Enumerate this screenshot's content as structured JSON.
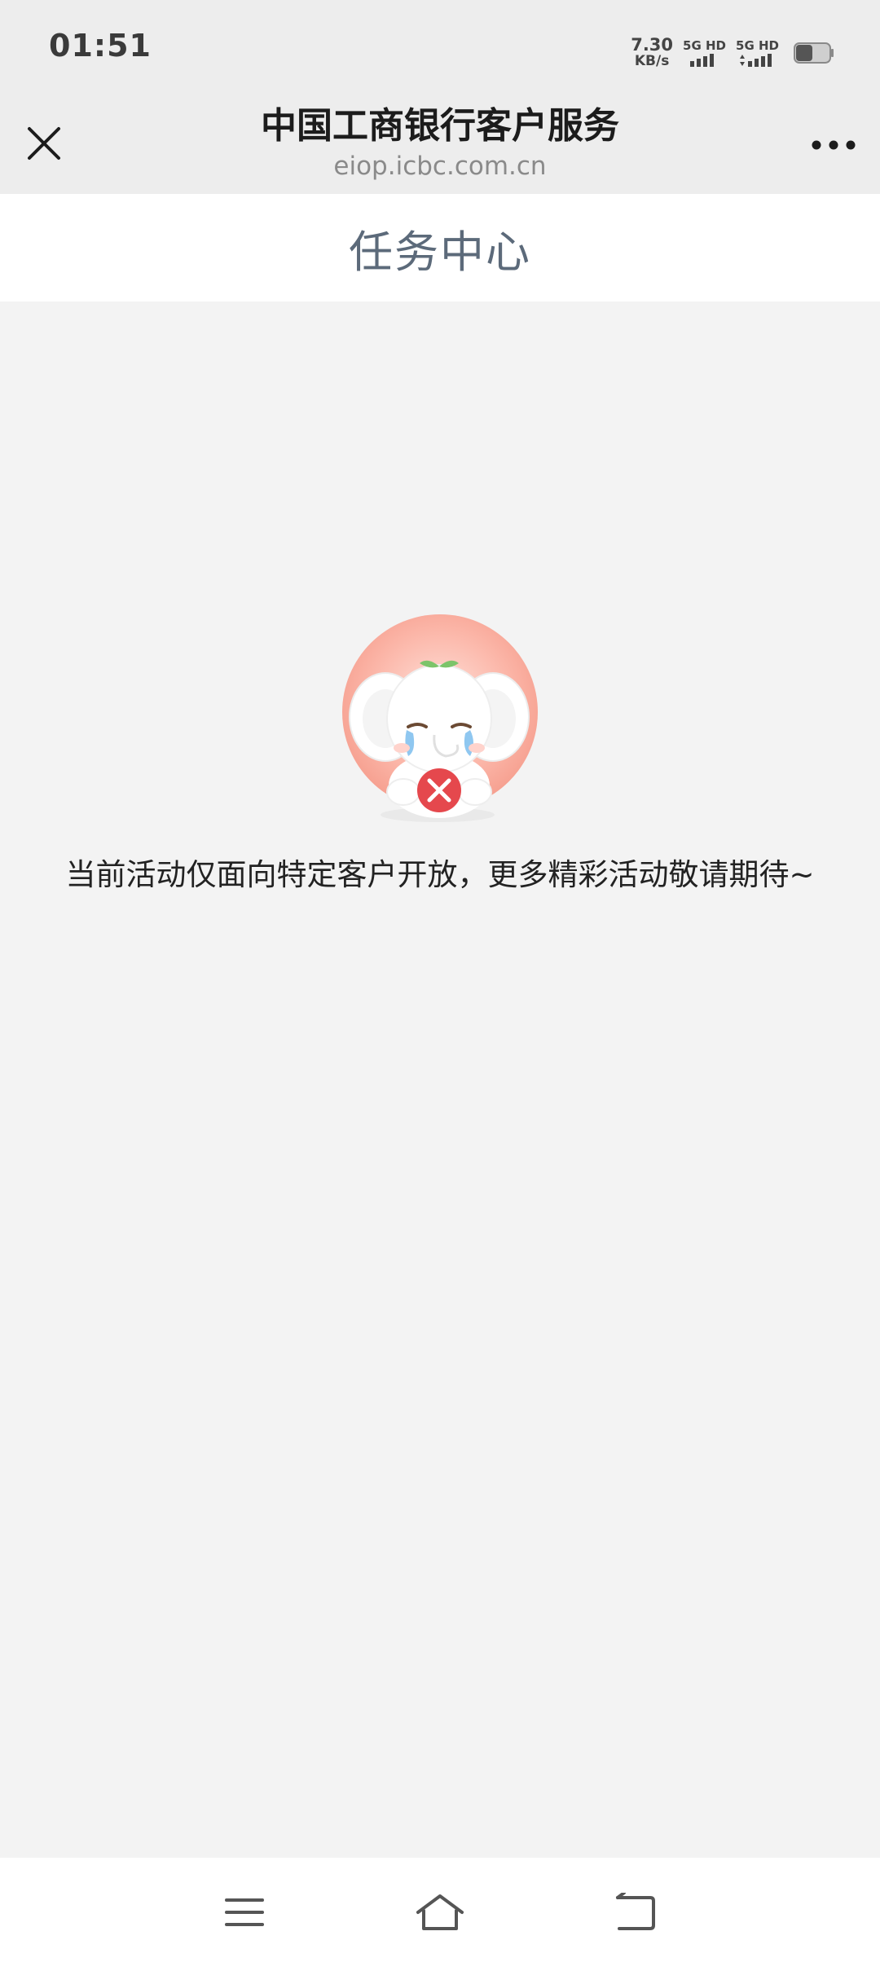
{
  "status_bar": {
    "time": "01:51",
    "net_speed_value": "7.30",
    "net_speed_unit": "KB/s",
    "sim1_label": "5G HD",
    "sim2_label": "5G HD",
    "battery_icon": "battery-low-icon"
  },
  "nav": {
    "title": "中国工商银行客户服务",
    "url": "eiop.icbc.com.cn",
    "close_icon": "close-icon",
    "more_icon": "more-dots-icon"
  },
  "page": {
    "title": "任务中心"
  },
  "content": {
    "illustration": "crying-elephant-mascot-with-error-icon",
    "message": "当前活动仅面向特定客户开放，更多精彩活动敬请期待~"
  },
  "system_nav": {
    "menu_icon": "menu-icon",
    "home_icon": "home-icon",
    "back_icon": "back-icon"
  },
  "colors": {
    "status_bg": "#ededed",
    "page_bg": "#f3f3f3",
    "header_bg": "#ffffff",
    "title_color": "#5c6a7a",
    "error_red": "#e5484d",
    "mascot_circle": "#f7b3a6"
  }
}
